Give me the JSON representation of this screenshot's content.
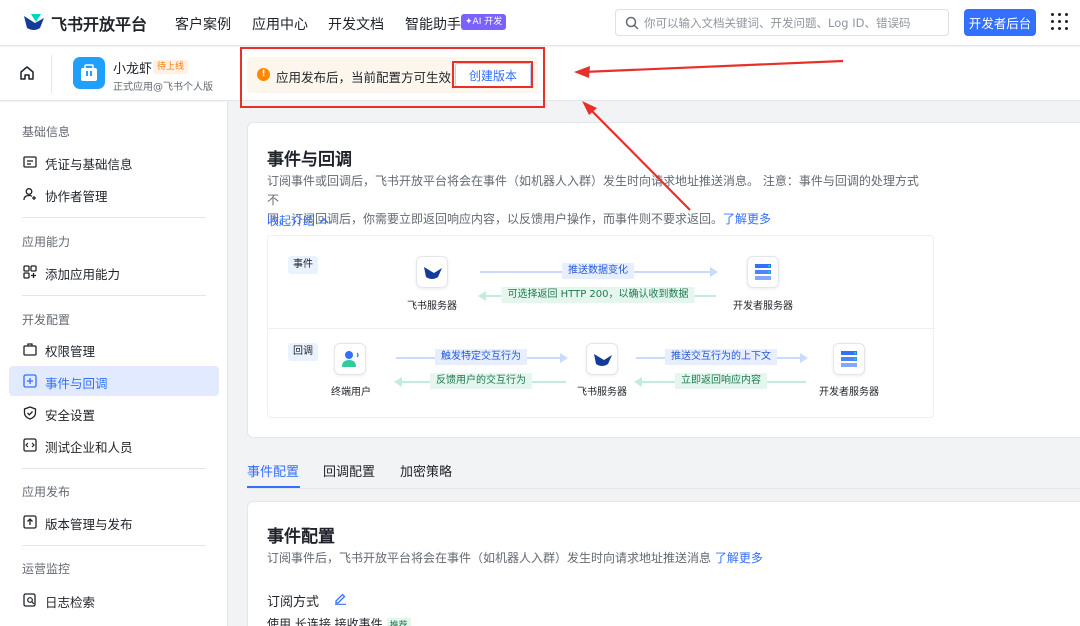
{
  "topnav": {
    "brand": "飞书开放平台",
    "links": [
      "客户案例",
      "应用中心",
      "开发文档",
      "智能助手"
    ],
    "ai_badge": "✦AI 开发",
    "search_placeholder": "你可以输入文档关键词、开发问题、Log ID、错误码",
    "dev_console": "开发者后台"
  },
  "app": {
    "name": "小龙虾",
    "status": "待上线",
    "subtitle": "正式应用@飞书个人版"
  },
  "notice": {
    "text": "应用发布后，当前配置方可生效",
    "action": "创建版本"
  },
  "sidebar": {
    "groups": [
      {
        "title": "基础信息",
        "items": [
          {
            "label": "凭证与基础信息",
            "icon": "id-card-icon"
          },
          {
            "label": "协作者管理",
            "icon": "user-add-icon"
          }
        ]
      },
      {
        "title": "应用能力",
        "items": [
          {
            "label": "添加应用能力",
            "icon": "apps-add-icon"
          }
        ]
      },
      {
        "title": "开发配置",
        "items": [
          {
            "label": "权限管理",
            "icon": "briefcase-icon"
          },
          {
            "label": "事件与回调",
            "icon": "event-icon",
            "active": true
          },
          {
            "label": "安全设置",
            "icon": "shield-icon"
          },
          {
            "label": "测试企业和人员",
            "icon": "code-box-icon"
          }
        ]
      },
      {
        "title": "应用发布",
        "items": [
          {
            "label": "版本管理与发布",
            "icon": "upload-box-icon"
          }
        ]
      },
      {
        "title": "运营监控",
        "items": [
          {
            "label": "日志检索",
            "icon": "log-search-icon"
          }
        ]
      }
    ]
  },
  "intro": {
    "title": "事件与回调",
    "desc_line1": "订阅事件或回调后，飞书开放平台将会在事件（如机器人入群）发生时向请求地址推送消息。 注意：事件与回调的处理方式不",
    "desc_line2": "同。订阅回调后，你需要立即返回响应内容，以反馈用户操作，而事件则不要求返回。",
    "learn_more": "了解更多",
    "collapse": "收起介绍"
  },
  "diagram": {
    "event": {
      "tag": "事件",
      "from": "飞书服务器",
      "to": "开发者服务器",
      "forward": "推送数据变化",
      "back": "可选择返回 HTTP 200，以确认收到数据"
    },
    "callback": {
      "tag": "回调",
      "user": "终端用户",
      "mid": "飞书服务器",
      "to": "开发者服务器",
      "f1": "触发特定交互行为",
      "b1": "反馈用户的交互行为",
      "f2": "推送交互行为的上下文",
      "b2": "立即返回响应内容"
    }
  },
  "tabs": [
    "事件配置",
    "回调配置",
    "加密策略"
  ],
  "event_config": {
    "title": "事件配置",
    "desc": "订阅事件后，飞书开放平台将会在事件（如机器人入群）发生时向请求地址推送消息",
    "learn_more": "了解更多",
    "subscribe_label": "订阅方式",
    "cut_text": "使用 长连接 接收事件",
    "cut_badge": "推荐"
  },
  "colors": {
    "primary": "#3370ff",
    "annotation_red": "#e8302a",
    "notice_bg": "#fdf6ec",
    "warn": "#ff8800"
  }
}
